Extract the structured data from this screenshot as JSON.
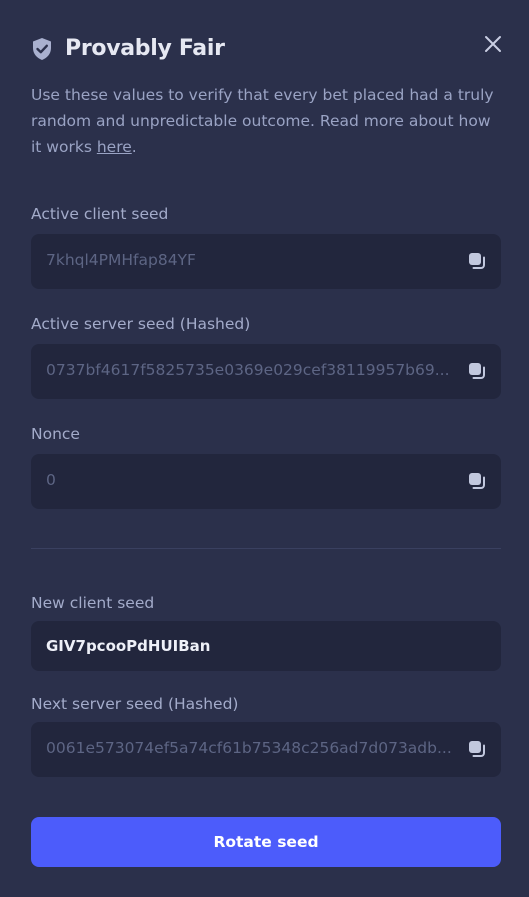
{
  "header": {
    "title": "Provably Fair",
    "icon": "shield-check-icon"
  },
  "description": {
    "text": "Use these values to verify that every bet placed had a truly random and unpredictable outcome. Read more about how it works ",
    "link_label": "here",
    "suffix": "."
  },
  "fields": {
    "active_client_seed": {
      "label": "Active client seed",
      "value": "7khql4PMHfap84YF"
    },
    "active_server_seed": {
      "label": "Active server seed (Hashed)",
      "value": "0737bf4617f5825735e0369e029cef38119957b69..."
    },
    "nonce": {
      "label": "Nonce",
      "value": "0"
    },
    "new_client_seed": {
      "label": "New client seed",
      "value": "GIV7pcooPdHUIBan"
    },
    "next_server_seed": {
      "label": "Next server seed (Hashed)",
      "value": "0061e573074ef5a74cf61b75348c256ad7d073adb..."
    }
  },
  "actions": {
    "rotate_label": "Rotate seed"
  },
  "colors": {
    "background": "#2b304b",
    "field_bg": "#22263d",
    "accent": "#4c5cfb",
    "muted_text": "#9aa3c4"
  }
}
